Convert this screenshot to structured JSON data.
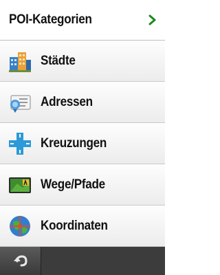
{
  "header": {
    "title": "POI-Kategorien",
    "chevron_icon": "chevron-right-icon",
    "chevron_color": "#1a8a1a"
  },
  "items": [
    {
      "label": "Städte",
      "icon": "city-buildings-icon"
    },
    {
      "label": "Adressen",
      "icon": "address-card-icon"
    },
    {
      "label": "Kreuzungen",
      "icon": "intersection-icon"
    },
    {
      "label": "Wege/Pfade",
      "icon": "trail-sign-icon"
    },
    {
      "label": "Koordinaten",
      "icon": "globe-coordinates-icon"
    }
  ],
  "bottom_bar": {
    "back_icon": "back-arrow-icon"
  }
}
